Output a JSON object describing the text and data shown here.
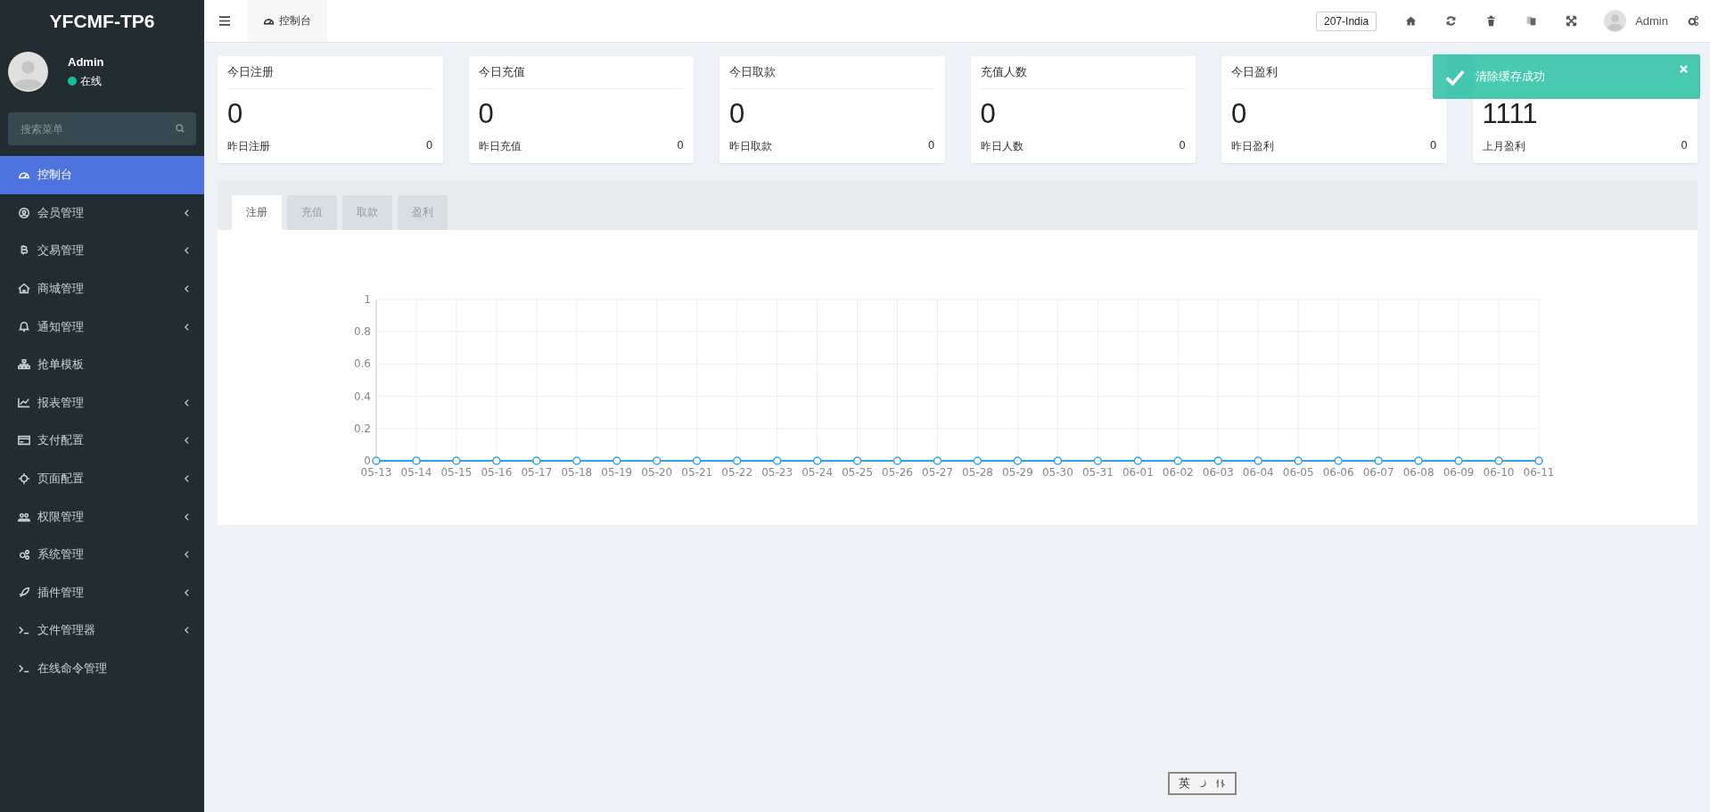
{
  "sidebar": {
    "brand": "YFCMF-TP6",
    "user": {
      "name": "Admin",
      "status": "在线",
      "online": true
    },
    "search": {
      "placeholder": "搜索菜单"
    },
    "items": [
      {
        "label": "控制台",
        "selected": true,
        "has_children": false
      },
      {
        "label": "会员管理",
        "selected": false,
        "has_children": true
      },
      {
        "label": "交易管理",
        "selected": false,
        "has_children": true
      },
      {
        "label": "商城管理",
        "selected": false,
        "has_children": true
      },
      {
        "label": "通知管理",
        "selected": false,
        "has_children": true
      },
      {
        "label": "抢单模板",
        "selected": false,
        "has_children": false
      },
      {
        "label": "报表管理",
        "selected": false,
        "has_children": true
      },
      {
        "label": "支付配置",
        "selected": false,
        "has_children": true
      },
      {
        "label": "页面配置",
        "selected": false,
        "has_children": true
      },
      {
        "label": "权限管理",
        "selected": false,
        "has_children": true
      },
      {
        "label": "系统管理",
        "selected": false,
        "has_children": true
      },
      {
        "label": "插件管理",
        "selected": false,
        "has_children": true
      },
      {
        "label": "文件管理器",
        "selected": false,
        "has_children": true
      },
      {
        "label": "在线命令管理",
        "selected": false,
        "has_children": false
      }
    ]
  },
  "topbar": {
    "tab": "控制台",
    "site": "207-India",
    "user": "Admin"
  },
  "cards": [
    {
      "title": "今日注册",
      "value": "0",
      "sub_label": "昨日注册",
      "sub_value": "0"
    },
    {
      "title": "今日充值",
      "value": "0",
      "sub_label": "昨日充值",
      "sub_value": "0"
    },
    {
      "title": "今日取款",
      "value": "0",
      "sub_label": "昨日取款",
      "sub_value": "0"
    },
    {
      "title": "充值人数",
      "value": "0",
      "sub_label": "昨日人数",
      "sub_value": "0"
    },
    {
      "title": "今日盈利",
      "value": "0",
      "sub_label": "昨日盈利",
      "sub_value": "0"
    },
    {
      "value": "1111",
      "sub_label": "上月盈利",
      "sub_value": "0"
    }
  ],
  "panel": {
    "tabs": [
      {
        "label": "注册",
        "selected": true
      },
      {
        "label": "充值",
        "selected": false
      },
      {
        "label": "取款",
        "selected": false
      },
      {
        "label": "盈利",
        "selected": false
      }
    ],
    "chart_data": {
      "type": "line",
      "categories": [
        "05-13",
        "05-14",
        "05-15",
        "05-16",
        "05-17",
        "05-18",
        "05-19",
        "05-20",
        "05-21",
        "05-22",
        "05-23",
        "05-24",
        "05-25",
        "05-26",
        "05-27",
        "05-28",
        "05-29",
        "05-30",
        "05-31",
        "06-01",
        "06-02",
        "06-03",
        "06-04",
        "06-05",
        "06-06",
        "06-07",
        "06-08",
        "06-09",
        "06-10",
        "06-11"
      ],
      "grid": true,
      "series": [
        {
          "color": "#2fa4e7",
          "marker": true,
          "values": [
            0,
            0,
            0,
            0,
            0,
            0,
            0,
            0,
            0,
            0,
            0,
            0,
            0,
            0,
            0,
            0,
            0,
            0,
            0,
            0,
            0,
            0,
            0,
            0,
            0,
            0,
            0,
            0,
            0,
            0
          ]
        }
      ],
      "ylim": [
        0,
        1
      ],
      "yticks": [
        0,
        0.2,
        0.4,
        0.6,
        0.8,
        1
      ]
    }
  },
  "toast": {
    "message": "清除缓存成功"
  },
  "ime_bar": {
    "mode": "英"
  }
}
